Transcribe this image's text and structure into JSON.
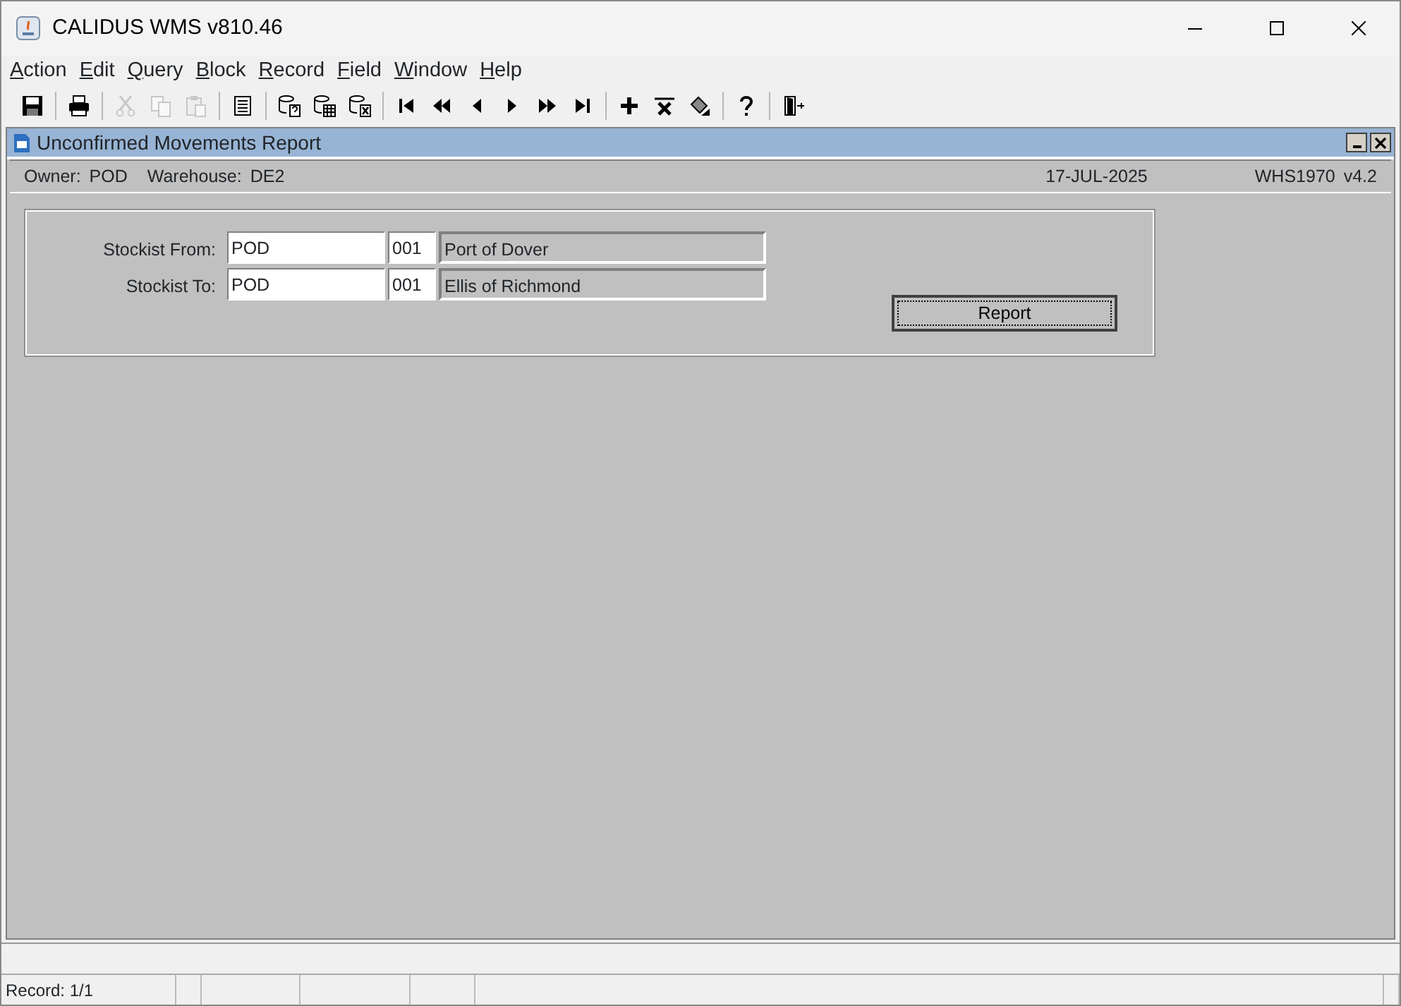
{
  "window": {
    "title": "CALIDUS WMS v810.46"
  },
  "menu": [
    "Action",
    "Edit",
    "Query",
    "Block",
    "Record",
    "Field",
    "Window",
    "Help"
  ],
  "toolbar": [
    [
      {
        "kind": "save",
        "disabled": false
      }
    ],
    [
      {
        "kind": "print",
        "disabled": false
      }
    ],
    [
      {
        "kind": "cut",
        "disabled": true
      },
      {
        "kind": "copy",
        "disabled": true
      },
      {
        "kind": "paste",
        "disabled": true
      }
    ],
    [
      {
        "kind": "list",
        "disabled": false
      }
    ],
    [
      {
        "kind": "query",
        "disabled": false
      },
      {
        "kind": "execute",
        "disabled": false
      },
      {
        "kind": "cancel",
        "disabled": false
      }
    ],
    [
      {
        "kind": "first",
        "disabled": false
      },
      {
        "kind": "prevset",
        "disabled": false
      },
      {
        "kind": "prev",
        "disabled": false
      },
      {
        "kind": "next",
        "disabled": false
      },
      {
        "kind": "nextset",
        "disabled": false
      },
      {
        "kind": "last",
        "disabled": false
      }
    ],
    [
      {
        "kind": "insert",
        "disabled": false
      },
      {
        "kind": "delete",
        "disabled": false
      },
      {
        "kind": "clear",
        "disabled": false
      }
    ],
    [
      {
        "kind": "help",
        "disabled": false
      }
    ],
    [
      {
        "kind": "exit",
        "disabled": false
      }
    ]
  ],
  "form": {
    "title": "Unconfirmed Movements Report",
    "info": {
      "owner_label": "Owner:",
      "owner": "POD",
      "warehouse_label": "Warehouse:",
      "warehouse": "DE2",
      "date": "17-JUL-2025",
      "module": "WHS1970",
      "version": "v4.2"
    },
    "fields": [
      {
        "label": "Stockist From:",
        "value": "POD",
        "code": "001",
        "name": "Port of Dover"
      },
      {
        "label": "Stockist To:",
        "value": "POD",
        "code": "001",
        "name": "Ellis of Richmond"
      }
    ],
    "button": "Report"
  },
  "status_bar": {
    "record": "Record: 1/1"
  }
}
